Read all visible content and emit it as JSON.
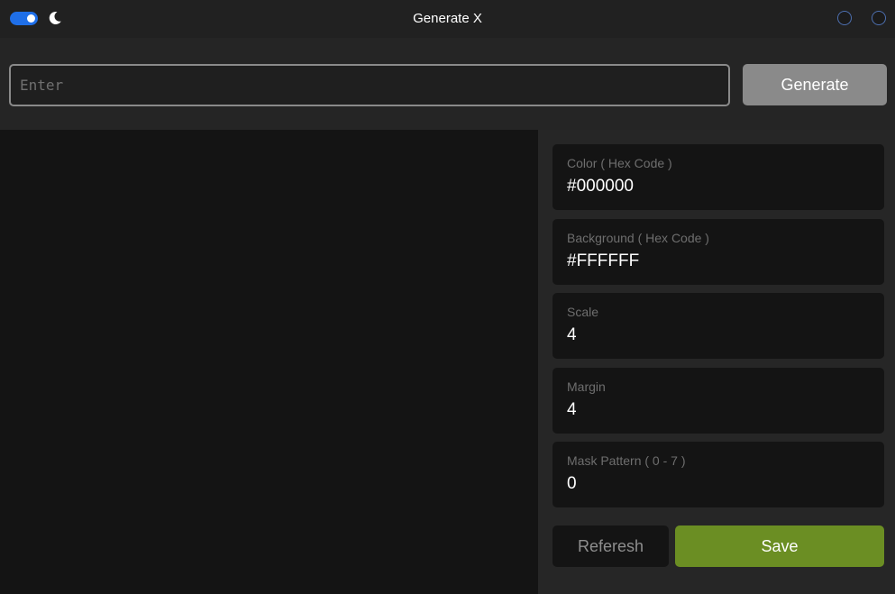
{
  "window": {
    "title": "Generate X",
    "theme_toggle": {
      "enabled": true,
      "accent": "#1f6fe8"
    },
    "theme_icon": "moon-icon"
  },
  "input": {
    "placeholder": "Enter",
    "value": "",
    "generate_label": "Generate"
  },
  "options": {
    "color": {
      "label": "Color ( Hex Code )",
      "value": "#000000"
    },
    "background": {
      "label": "Background ( Hex Code )",
      "value": "#FFFFFF"
    },
    "scale": {
      "label": "Scale",
      "value": "4"
    },
    "margin": {
      "label": "Margin",
      "value": "4"
    },
    "mask_pattern": {
      "label": "Mask Pattern ( 0 - 7 )",
      "value": "0"
    }
  },
  "actions": {
    "refresh_label": "Referesh",
    "save_label": "Save",
    "save_color": "#6b8e23"
  }
}
